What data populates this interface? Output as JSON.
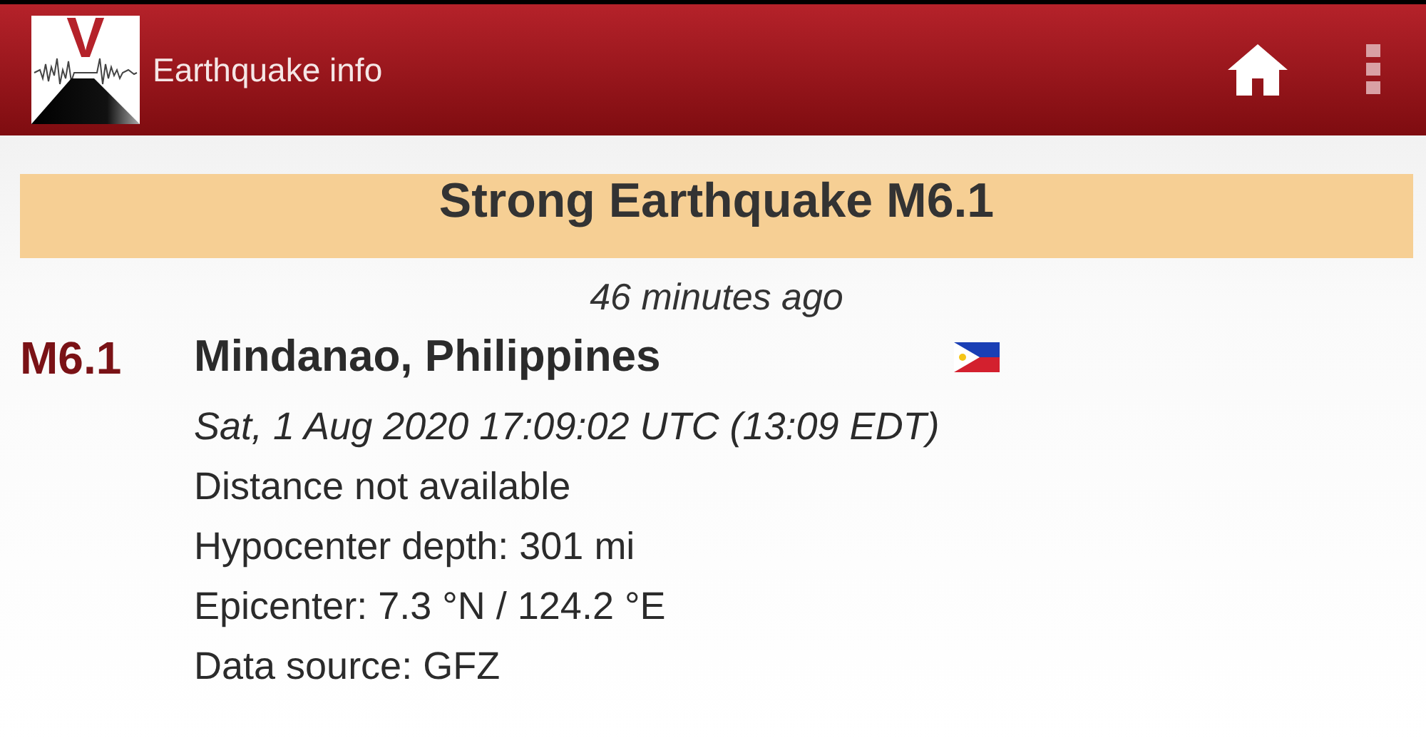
{
  "app_bar": {
    "logo_letter": "V",
    "title": "Earthquake info"
  },
  "banner": {
    "title": "Strong Earthquake M6.1"
  },
  "time_ago": "46 minutes ago",
  "event": {
    "magnitude": "M6.1",
    "location": "Mindanao, Philippines",
    "datetime": "Sat, 1 Aug 2020 17:09:02 UTC (13:09 EDT)",
    "details": [
      "Distance not available",
      "Hypocenter depth: 301 mi",
      "Epicenter: 7.3 °N / 124.2 °E",
      "Data source: GFZ"
    ]
  }
}
